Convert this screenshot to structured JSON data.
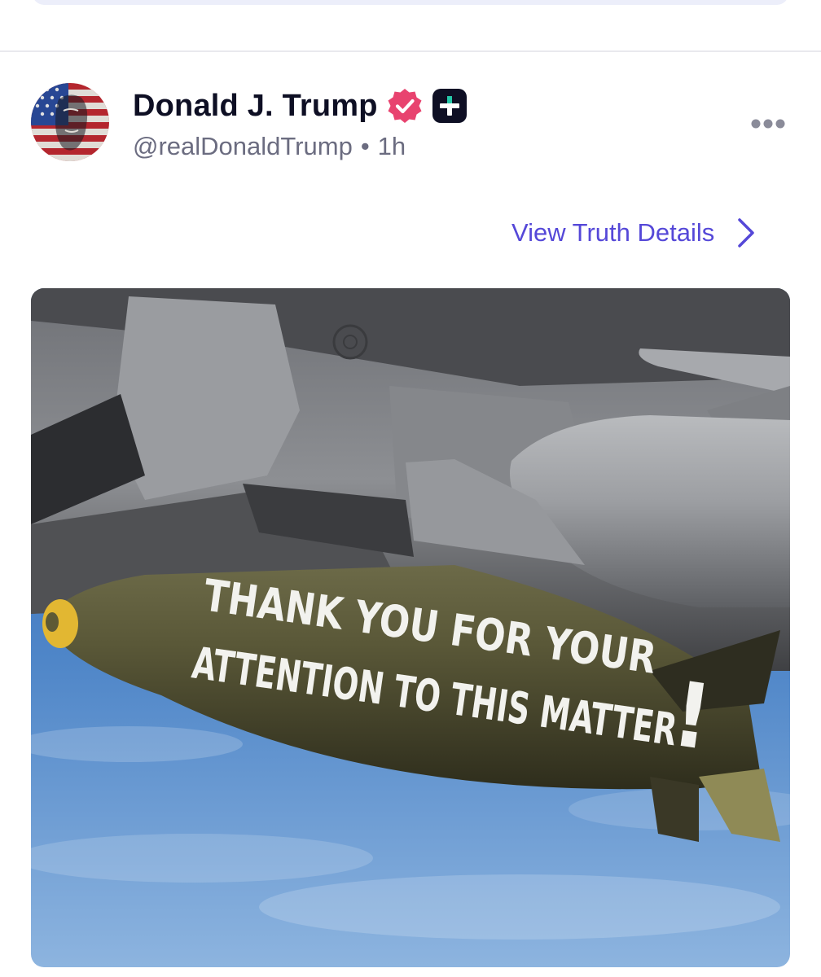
{
  "post": {
    "author": {
      "display_name": "Donald J. Trump",
      "handle": "@realDonaldTrump",
      "verified_icon": "verified-badge-icon",
      "subscriber_icon": "truth-plus-icon"
    },
    "separator": "•",
    "timestamp": "1h",
    "more_icon": "more-horizontal-icon",
    "details_link": {
      "label": "View Truth Details",
      "icon": "chevron-right-icon"
    },
    "media": {
      "type": "image",
      "bomb_text_line1": "THANK YOU FOR YOUR",
      "bomb_text_line2": "ATTENTION TO THIS MATTER",
      "bomb_text_exclaim": "!"
    }
  },
  "colors": {
    "name_text": "#0e0f24",
    "secondary_text": "#6b6c80",
    "link_accent": "#5548d8",
    "verified_badge": "#e8436f",
    "plus_badge": "#0e0f24",
    "plus_badge_accent": "#23c9a9",
    "divider": "#e9e9ee"
  }
}
